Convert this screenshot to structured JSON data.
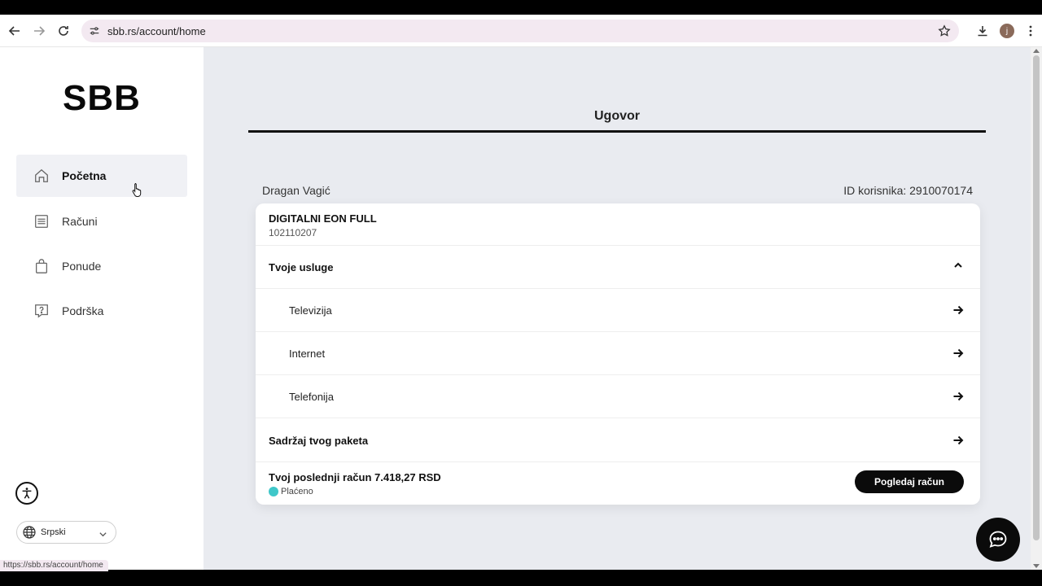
{
  "browser": {
    "url": "sbb.rs/account/home",
    "profile_initial": "j",
    "status_url": "https://sbb.rs/account/home"
  },
  "sidebar": {
    "logo": "SBB",
    "items": [
      {
        "label": "Početna",
        "icon": "home-icon",
        "active": true
      },
      {
        "label": "Računi",
        "icon": "invoice-icon",
        "active": false
      },
      {
        "label": "Ponude",
        "icon": "shopping-bag-icon",
        "active": false
      },
      {
        "label": "Podrška",
        "icon": "help-icon",
        "active": false
      }
    ],
    "language": "Srpski"
  },
  "main": {
    "title": "Ugovor",
    "user_name": "Dragan Vagić",
    "user_id": "ID korisnika: 2910070174",
    "package": {
      "name": "DIGITALNI EON FULL",
      "number": "102110207"
    },
    "services_header": "Tvoje usluge",
    "services": [
      "Televizija",
      "Internet",
      "Telefonija"
    ],
    "package_content": "Sadržaj tvog paketa",
    "last_bill": "Tvoj poslednji račun 7.418,27 RSD",
    "bill_status": "Plaćeno",
    "view_bill_button": "Pogledaj račun"
  },
  "colors": {
    "accent": "#0b0b0b",
    "page_bg": "#e9ebf0",
    "paid": "#3fc7c9",
    "omnibox": "#f3e9f1"
  }
}
